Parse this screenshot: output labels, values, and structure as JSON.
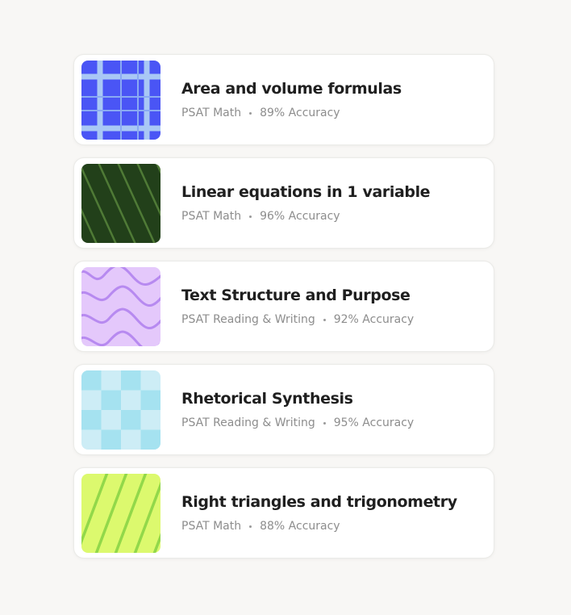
{
  "skills": [
    {
      "title": "Area and volume formulas",
      "subject": "PSAT Math",
      "accuracy": "89% Accuracy",
      "thumbnail": {
        "icon": "grid-pattern-icon",
        "background": "#4a55f5",
        "accent": "#a9c8f5"
      }
    },
    {
      "title": "Linear equations in 1 variable",
      "subject": "PSAT Math",
      "accuracy": "96% Accuracy",
      "thumbnail": {
        "icon": "diagonal-lines-pattern-icon",
        "background": "#22401a",
        "accent": "#4f7a36"
      }
    },
    {
      "title": "Text Structure and Purpose",
      "subject": "PSAT Reading & Writing",
      "accuracy": "92% Accuracy",
      "thumbnail": {
        "icon": "wave-pattern-icon",
        "background": "#e4c8fb",
        "accent": "#b78af0"
      }
    },
    {
      "title": "Rhetorical Synthesis",
      "subject": "PSAT Reading & Writing",
      "accuracy": "95% Accuracy",
      "thumbnail": {
        "icon": "checkerboard-pattern-icon",
        "background": "#cdedf6",
        "accent": "#a5e2f0"
      }
    },
    {
      "title": "Right triangles and trigonometry",
      "subject": "PSAT Math",
      "accuracy": "88% Accuracy",
      "thumbnail": {
        "icon": "diagonal-stripes-pattern-icon",
        "background": "#dcf96e",
        "accent": "#92d84a"
      }
    }
  ]
}
